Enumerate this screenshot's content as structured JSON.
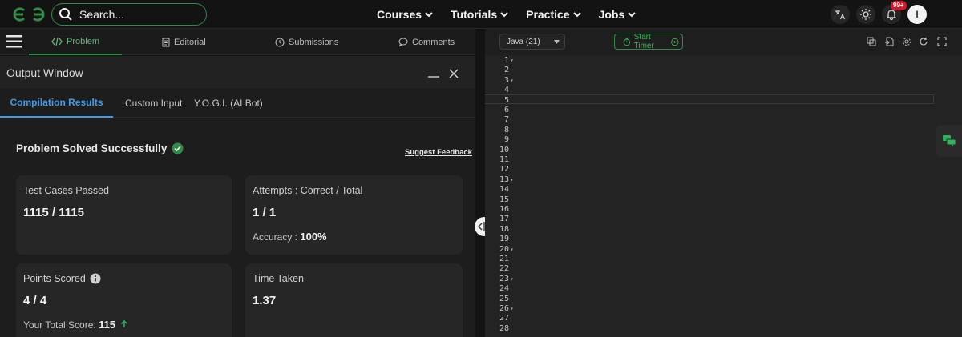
{
  "nav": {
    "search_placeholder": "Search...",
    "menu": [
      {
        "label": "Courses"
      },
      {
        "label": "Tutorials"
      },
      {
        "label": "Practice"
      },
      {
        "label": "Jobs"
      }
    ],
    "notification_count": "99+",
    "avatar_initial": "I",
    "brand_color": "#2f8d46"
  },
  "problem_tabs": [
    {
      "label": "Problem",
      "icon": "code-icon"
    },
    {
      "label": "Editorial",
      "icon": "document-icon"
    },
    {
      "label": "Submissions",
      "icon": "clock-icon"
    },
    {
      "label": "Comments",
      "icon": "comment-icon"
    }
  ],
  "output": {
    "title": "Output Window",
    "tabs": [
      {
        "label": "Compilation Results"
      },
      {
        "label": "Custom Input"
      },
      {
        "label": "Y.O.G.I. (AI Bot)"
      }
    ],
    "status": "Problem Solved Successfully",
    "feedback_link": "Suggest Feedback",
    "cards": {
      "tests": {
        "label": "Test Cases Passed",
        "value": "1115 / 1115"
      },
      "attempts": {
        "label": "Attempts : Correct / Total",
        "value": "1 / 1",
        "sub_label": "Accuracy : ",
        "sub_value": "100%"
      },
      "points": {
        "label": "Points Scored",
        "value": "4 / 4",
        "sub_label": "Your Total Score: ",
        "sub_value": "115"
      },
      "time": {
        "label": "Time Taken",
        "value": "1.37"
      }
    }
  },
  "editor": {
    "language": "Java (21)",
    "timer_label": "Start Timer",
    "line_numbers": [
      "1",
      "2",
      "3",
      "4",
      "5",
      "6",
      "7",
      "8",
      "9",
      "10",
      "11",
      "12",
      "13",
      "14",
      "15",
      "16",
      "17",
      "18",
      "19",
      "20",
      "21",
      "22",
      "23",
      "24",
      "25",
      "26",
      "27",
      "28"
    ]
  }
}
